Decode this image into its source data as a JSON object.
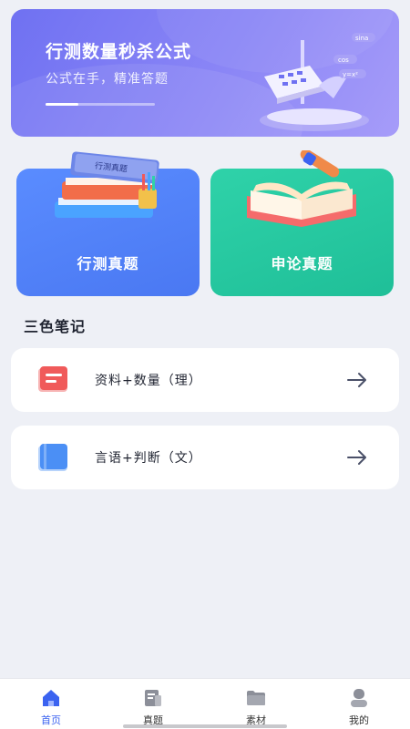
{
  "banner": {
    "title": "行测数量秒杀公式",
    "subtitle": "公式在手，精准答题",
    "progress": 0.3,
    "art_texts": [
      "cos",
      "sina",
      "y=x²"
    ]
  },
  "categories": [
    {
      "label": "行测真题",
      "book_text": "行测真题",
      "color": "#4a78f2"
    },
    {
      "label": "申论真题",
      "color": "#1fbf98"
    }
  ],
  "section": {
    "title": "三色笔记"
  },
  "notes": [
    {
      "label": "资料+数量（理）",
      "icon": "red-notebook-icon",
      "color": "#f05a5a"
    },
    {
      "label": "言语+判断（文）",
      "icon": "blue-notebook-icon",
      "color": "#4b8ff5"
    }
  ],
  "nav": [
    {
      "label": "首页",
      "icon": "home-icon",
      "active": true
    },
    {
      "label": "真题",
      "icon": "document-icon",
      "active": false
    },
    {
      "label": "素材",
      "icon": "folder-icon",
      "active": false
    },
    {
      "label": "我的",
      "icon": "user-icon",
      "active": false
    }
  ],
  "colors": {
    "accent": "#3b63f0",
    "background": "#eef0f6"
  }
}
